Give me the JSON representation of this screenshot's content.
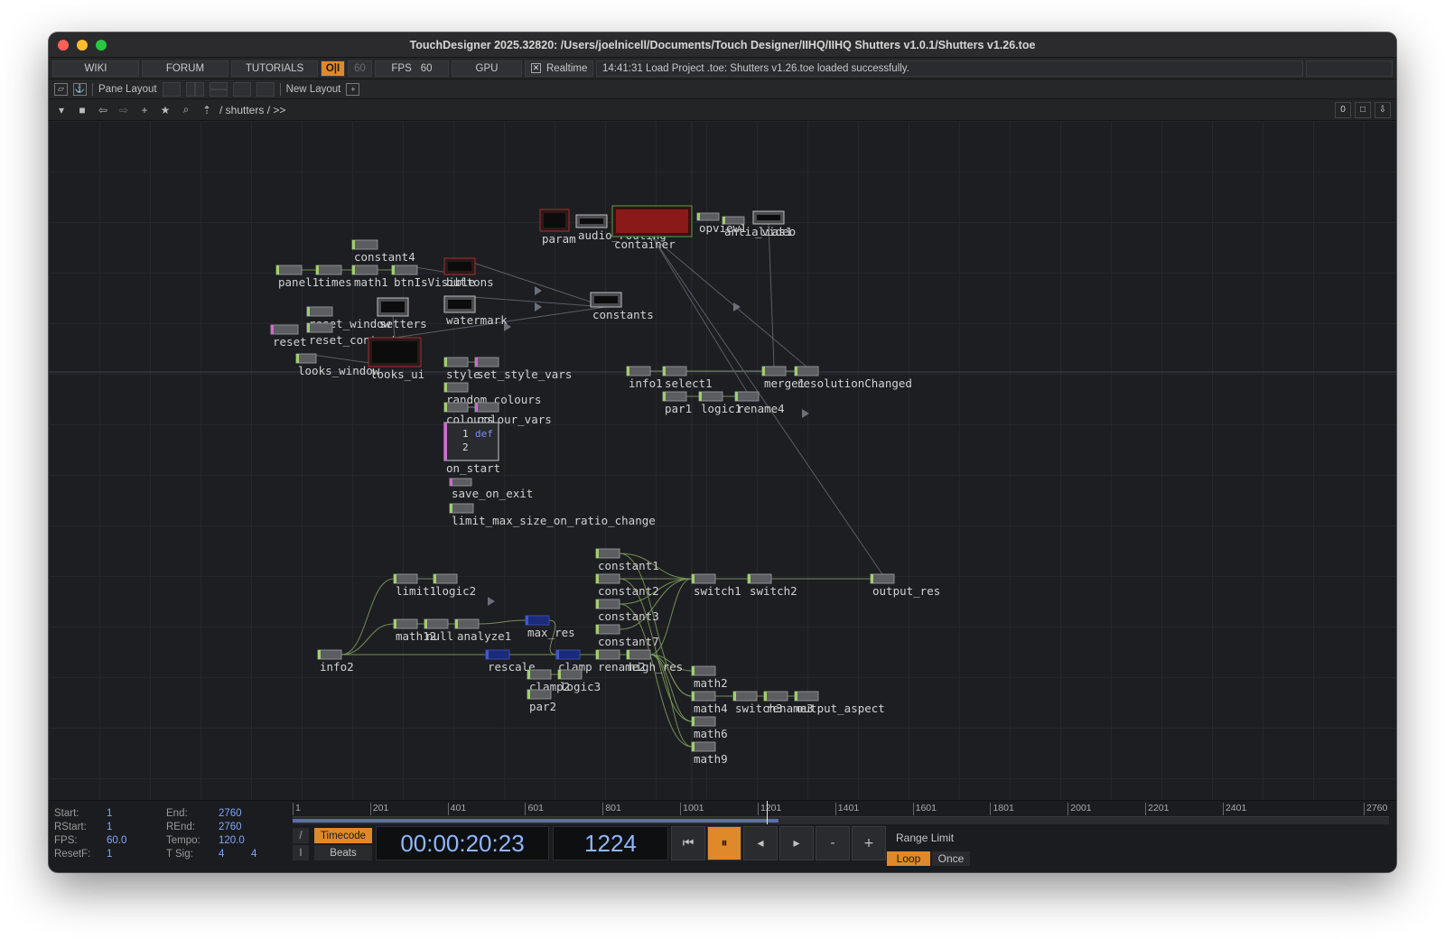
{
  "window": {
    "title": "TouchDesigner 2025.32820: /Users/joelnicell/Documents/Touch Designer/IIHQ/IIHQ Shutters v1.0.1/Shutters v1.26.toe"
  },
  "menubar": {
    "wiki": "WIKI",
    "forum": "FORUM",
    "tutorials": "TUTORIALS",
    "oi": "O|I",
    "fps_cap": "60",
    "fps_label": "FPS",
    "fps_value": "60",
    "gpu": "GPU",
    "realtime_label": "Realtime",
    "realtime_checked": true,
    "status_message": "14:41:31 Load Project .toe: Shutters v1.26.toe loaded successfully."
  },
  "panebar": {
    "pane_layout": "Pane Layout",
    "new_layout": "New Layout",
    "add": "+"
  },
  "pathbar": {
    "path": "/ shutters / >>",
    "right_value": "0"
  },
  "nodes": [
    {
      "label": "param",
      "kind": "red"
    },
    {
      "label": "audio_routing",
      "kind": "box"
    },
    {
      "label": "container",
      "kind": "green"
    },
    {
      "label": "opview1",
      "kind": "op"
    },
    {
      "label": "antialias1",
      "kind": "op"
    },
    {
      "label": "_video",
      "kind": "box"
    },
    {
      "label": "constant4",
      "kind": "op"
    },
    {
      "label": "panel1",
      "kind": "op"
    },
    {
      "label": "times",
      "kind": "op"
    },
    {
      "label": "math1",
      "kind": "op"
    },
    {
      "label": "btnIsVisible",
      "kind": "op"
    },
    {
      "label": "buttons",
      "kind": "red"
    },
    {
      "label": "constants",
      "kind": "box"
    },
    {
      "label": "watermark",
      "kind": "box"
    },
    {
      "label": "reset_window",
      "kind": "op"
    },
    {
      "label": "setters",
      "kind": "box"
    },
    {
      "label": "reset",
      "kind": "pink"
    },
    {
      "label": "reset_content",
      "kind": "op"
    },
    {
      "label": "looks_window",
      "kind": "op"
    },
    {
      "label": "looks_ui",
      "kind": "red"
    },
    {
      "label": "style",
      "kind": "op"
    },
    {
      "label": "set_style_vars",
      "kind": "pink"
    },
    {
      "label": "random_colours",
      "kind": "op"
    },
    {
      "label": "colours",
      "kind": "op"
    },
    {
      "label": "colour_vars",
      "kind": "pink"
    },
    {
      "label": "on_start",
      "kind": "dat"
    },
    {
      "label": "save_on_exit",
      "kind": "pink"
    },
    {
      "label": "limit_max_size_on_ratio_change",
      "kind": "op"
    },
    {
      "label": "info1",
      "kind": "op"
    },
    {
      "label": "select1",
      "kind": "op"
    },
    {
      "label": "merge1",
      "kind": "op"
    },
    {
      "label": "resolutionChanged",
      "kind": "op"
    },
    {
      "label": "par1",
      "kind": "op"
    },
    {
      "label": "logic1",
      "kind": "op"
    },
    {
      "label": "rename4",
      "kind": "op"
    },
    {
      "label": "constant1",
      "kind": "op"
    },
    {
      "label": "constant2",
      "kind": "op"
    },
    {
      "label": "constant3",
      "kind": "op"
    },
    {
      "label": "constant7",
      "kind": "op"
    },
    {
      "label": "switch1",
      "kind": "op"
    },
    {
      "label": "switch2",
      "kind": "op"
    },
    {
      "label": "output_res",
      "kind": "op"
    },
    {
      "label": "limit1",
      "kind": "op"
    },
    {
      "label": "logic2",
      "kind": "op"
    },
    {
      "label": "math12",
      "kind": "op"
    },
    {
      "label": "null",
      "kind": "op"
    },
    {
      "label": "analyze1",
      "kind": "op"
    },
    {
      "label": "max_res",
      "kind": "blue"
    },
    {
      "label": "info2",
      "kind": "op"
    },
    {
      "label": "rescale",
      "kind": "blue"
    },
    {
      "label": "clamp",
      "kind": "blue"
    },
    {
      "label": "rename2",
      "kind": "op"
    },
    {
      "label": "high_res",
      "kind": "op"
    },
    {
      "label": "clamp2",
      "kind": "op"
    },
    {
      "label": "logic3",
      "kind": "op"
    },
    {
      "label": "par2",
      "kind": "op"
    },
    {
      "label": "math2",
      "kind": "op"
    },
    {
      "label": "math4",
      "kind": "op"
    },
    {
      "label": "switch3",
      "kind": "op"
    },
    {
      "label": "rename3",
      "kind": "op"
    },
    {
      "label": "output_aspect",
      "kind": "op"
    },
    {
      "label": "math6",
      "kind": "op"
    },
    {
      "label": "math9",
      "kind": "op"
    }
  ],
  "on_start_preview": {
    "line1": "1",
    "text1": "def",
    "line2": "2"
  },
  "timeline": {
    "start_label": "Start:",
    "start": "1",
    "end_label": "End:",
    "end": "2760",
    "rstart_label": "RStart:",
    "rstart": "1",
    "rend_label": "REnd:",
    "rend": "2760",
    "fps_label": "FPS:",
    "fps": "60.0",
    "tempo_label": "Tempo:",
    "tempo": "120.0",
    "resetf_label": "ResetF:",
    "resetf": "1",
    "tsig_label": "T Sig:",
    "tsig_a": "4",
    "tsig_b": "4",
    "ruler_ticks": [
      "1",
      "201",
      "401",
      "601",
      "801",
      "1001",
      "1201",
      "1401",
      "1601",
      "1801",
      "2001",
      "2201",
      "2401",
      "2760"
    ],
    "timecode_btn": "Timecode",
    "beats_btn": "Beats",
    "timecode": "00:00:20:23",
    "frame": "1224",
    "range_limit": "Range Limit",
    "loop": "Loop",
    "once": "Once",
    "current_frame_value": 1224,
    "total_frames": 2760,
    "colors": {
      "accent": "#e0892a",
      "readout": "#8fb8ff"
    }
  }
}
